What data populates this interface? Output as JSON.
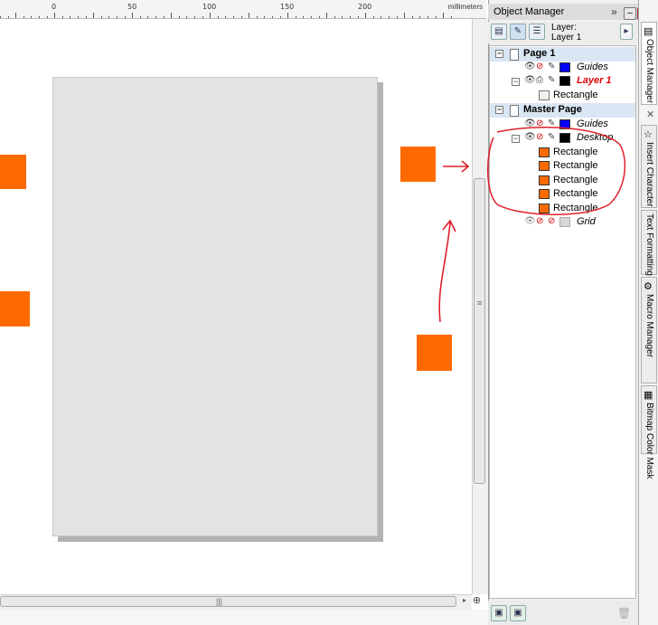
{
  "ruler": {
    "labels": [
      "0",
      "50",
      "100",
      "150",
      "200"
    ],
    "unit": "millimeters"
  },
  "canvas": {
    "page_color": "#e3e3e3",
    "shape_color": "#ff6a00",
    "annotation_color": "#e0202a"
  },
  "docker": {
    "title": "Object Manager",
    "layer_label": "Layer:",
    "layer_value": "Layer 1",
    "tree": {
      "page1": {
        "label": "Page 1",
        "items": [
          {
            "label": "Guides",
            "color": "#0000ff"
          },
          {
            "label": "Layer 1",
            "color": "#000000",
            "children": [
              "Rectangle"
            ]
          }
        ]
      },
      "master": {
        "label": "Master Page",
        "guides": "Guides",
        "desktop": "Desktop",
        "desktop_children": [
          "Rectangle",
          "Rectangle",
          "Rectangle",
          "Rectangle",
          "Rectangle"
        ],
        "grid": "Grid"
      }
    }
  },
  "side_tabs": [
    "Object Manager",
    "Insert Character",
    "Text Formatting",
    "Macro Manager",
    "Bitmap Color Mask"
  ]
}
